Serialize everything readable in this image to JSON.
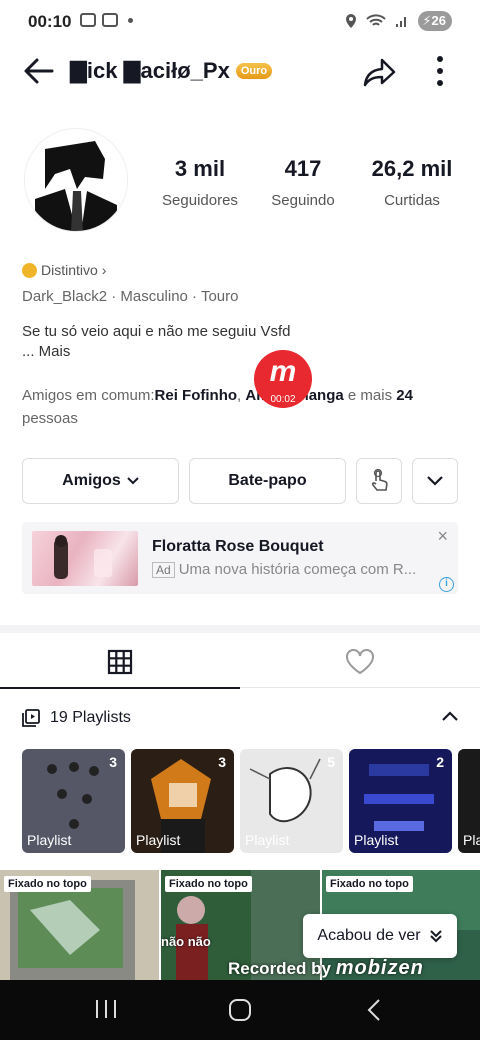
{
  "status_bar": {
    "time": "00:10",
    "battery": "26"
  },
  "header": {
    "username": "▇ick ▇aciłø_Px",
    "tier_badge": "Ouro"
  },
  "stats": [
    {
      "value": "3 mil",
      "label": "Seguidores"
    },
    {
      "value": "417",
      "label": "Seguindo"
    },
    {
      "value": "26,2 mil",
      "label": "Curtidas"
    }
  ],
  "profile": {
    "badge_label": "Distintivo",
    "badge_chevron": "›",
    "meta": "Dark_Black2  ·  Masculino  ·  Touro",
    "bio_line1": "Se tu só veio aqui e não me seguiu Vsfd",
    "bio_more": "...  Mais",
    "mutual_prefix": "Amigos em comum:",
    "mutual_friend1": "Rei Fofinho",
    "mutual_separator": ", ",
    "mutual_friend2": "Amigo Manga",
    "mutual_and": " e mais ",
    "mutual_count": "24",
    "mutual_suffix": " pessoas"
  },
  "recording_overlay": {
    "logo": "m",
    "timer": "00:02"
  },
  "actions": {
    "friends_label": "Amigos",
    "chat_label": "Bate-papo"
  },
  "ad": {
    "title": "Floratta Rose Bouquet",
    "tag": "Ad",
    "subtitle": "Uma nova história começa com R...",
    "close": "×",
    "info": "i"
  },
  "tabs": [
    {
      "icon": "grid-icon",
      "active": true
    },
    {
      "icon": "heart-icon",
      "active": false
    }
  ],
  "playlists_header": {
    "label": "19 Playlists"
  },
  "playlists": [
    {
      "label": "Playlist",
      "count": "3",
      "color": "#4a4a5a"
    },
    {
      "label": "Playlist",
      "count": "3",
      "color": "#3a2a1e"
    },
    {
      "label": "Playlist",
      "count": "5",
      "color": "#cfcfcf"
    },
    {
      "label": "Playlist",
      "count": "2",
      "color": "#1a1e5a"
    },
    {
      "label": "Pla",
      "count": "",
      "color": "#1a1a1a"
    }
  ],
  "videos": [
    {
      "pin": "Fixado no topo",
      "color": "#6d8f5e"
    },
    {
      "pin": "Fixado no topo",
      "caption": "não não",
      "color": "#2f5d3a"
    },
    {
      "pin": "Fixado no topo",
      "color": "#3e7c5a"
    }
  ],
  "watched_chip": {
    "label": "Acabou de ver"
  },
  "watermark": {
    "prefix": "Recorded by",
    "brand": "mobizen"
  }
}
